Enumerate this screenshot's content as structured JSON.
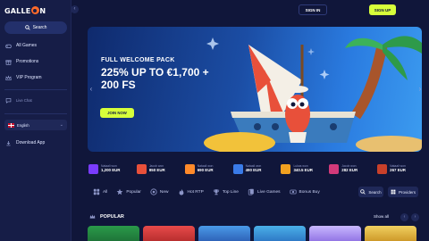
{
  "brand": {
    "name_prefix": "GALLE",
    "name_suffix": "N"
  },
  "header": {
    "sign_in": "SIGN IN",
    "sign_up": "SIGN UP"
  },
  "sidebar": {
    "search_label": "Search",
    "items": [
      {
        "label": "All Games",
        "icon": "gamepad-icon"
      },
      {
        "label": "Promotions",
        "icon": "gift-icon"
      },
      {
        "label": "VIP Program",
        "icon": "crown-icon"
      },
      {
        "label": "Live Chat",
        "icon": "chat-icon"
      }
    ],
    "language": "English",
    "download": "Download App"
  },
  "banner": {
    "eyebrow": "FULL WELCOME PACK",
    "headline": "225% UP TO €1,700 + 200 FS",
    "cta": "JOIN NOW"
  },
  "ticker": [
    {
      "label": "Nataali won",
      "value": "1,200 EUR",
      "color": "#7a3cff"
    },
    {
      "label": "Jacob won",
      "value": "850 EUR",
      "color": "#e8503a"
    },
    {
      "label": "Nataali won",
      "value": "690 EUR",
      "color": "#ff8a2a"
    },
    {
      "label": "Nataali won",
      "value": "490 EUR",
      "color": "#3a7be8"
    },
    {
      "label": "Lukas won",
      "value": "340.5 EUR",
      "color": "#f0a020"
    },
    {
      "label": "Jacob won",
      "value": "282 EUR",
      "color": "#d23a7a"
    },
    {
      "label": "Nataali won",
      "value": "267 EUR",
      "color": "#c8402a"
    }
  ],
  "categories": [
    {
      "label": "All",
      "icon": "grid-icon"
    },
    {
      "label": "Popular",
      "icon": "star-icon"
    },
    {
      "label": "New",
      "icon": "new-badge-icon"
    },
    {
      "label": "Hot RTP",
      "icon": "fire-icon"
    },
    {
      "label": "Top Line",
      "icon": "trophy-icon"
    },
    {
      "label": "Live Games",
      "icon": "cards-icon"
    },
    {
      "label": "Bonus Buy",
      "icon": "bonus-icon"
    }
  ],
  "category_search": "Search",
  "category_providers": "Providers",
  "popular": {
    "title": "POPULAR",
    "show_all": "Show all"
  },
  "colors": {
    "accent": "#d7ff3a",
    "sidebar": "#161d47",
    "background": "#10163a"
  }
}
